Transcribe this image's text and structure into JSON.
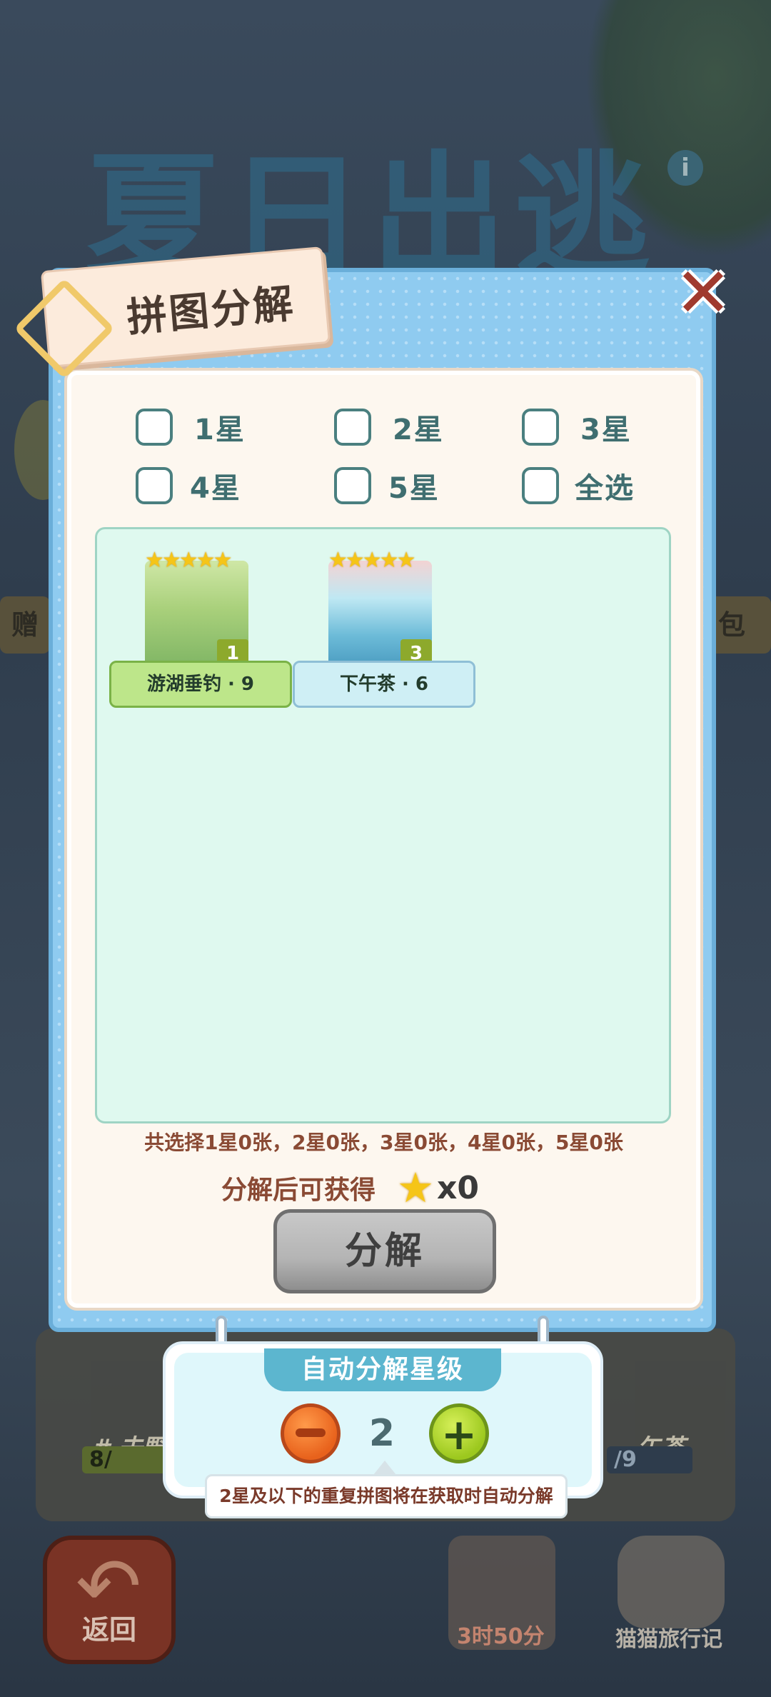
{
  "background": {
    "title": "夏日出逃记",
    "band_left": "赠",
    "band_right": "包",
    "lower_left_label": "# 去野",
    "lower_right_label": "午茶",
    "progress_left": "8/",
    "progress_right": "/9",
    "back_label": "返回",
    "timer_label": "3时50分",
    "cat_label": "猫猫旅行记"
  },
  "modal": {
    "title": "拼图分解",
    "filters": [
      {
        "label": "1星",
        "checked": false
      },
      {
        "label": "2星",
        "checked": false
      },
      {
        "label": "3星",
        "checked": false
      },
      {
        "label": "4星",
        "checked": false
      },
      {
        "label": "5星",
        "checked": false
      },
      {
        "label": "全选",
        "checked": false
      }
    ],
    "cards": [
      {
        "name": "游湖垂钓 · 9",
        "stars": "★★★★★",
        "count": "1"
      },
      {
        "name": "下午茶 · 6",
        "stars": "★★★★★",
        "count": "3"
      }
    ],
    "summary": "共选择1星0张，2星0张，3星0张，4星0张，5星0张",
    "reward_label": "分解后可获得",
    "reward_count": "x0",
    "decompose_button": "分解"
  },
  "auto_decompose": {
    "header": "自动分解星级",
    "value": "2",
    "tooltip": "2星及以下的重复拼图将在获取时自动分解"
  }
}
